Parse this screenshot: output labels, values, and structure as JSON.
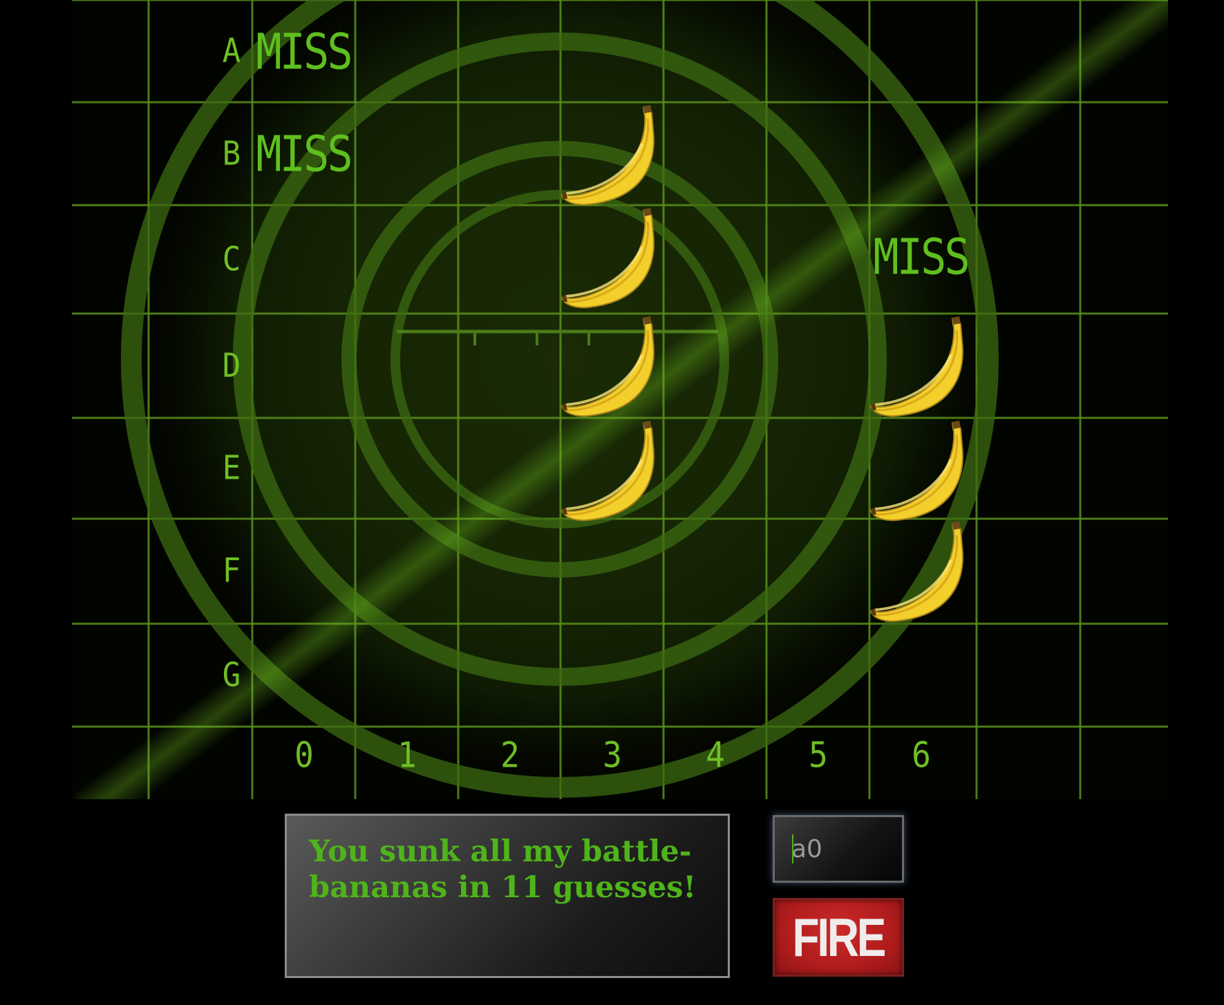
{
  "board": {
    "rows": [
      "A",
      "B",
      "C",
      "D",
      "E",
      "F",
      "G"
    ],
    "columns": [
      "0",
      "1",
      "2",
      "3",
      "4",
      "5",
      "6"
    ],
    "miss_label": "MISS",
    "misses": [
      {
        "row": 0,
        "col": 0
      },
      {
        "row": 1,
        "col": 0
      },
      {
        "row": 2,
        "col": 6
      }
    ],
    "hits": [
      {
        "row": 1,
        "col": 3
      },
      {
        "row": 2,
        "col": 3
      },
      {
        "row": 3,
        "col": 3
      },
      {
        "row": 4,
        "col": 3
      },
      {
        "row": 3,
        "col": 6
      },
      {
        "row": 4,
        "col": 6
      },
      {
        "row": 5,
        "col": 6
      }
    ],
    "hit_icon": "banana-icon"
  },
  "message": "You sunk all my battle-bananas in 11 guesses!",
  "guess_input": {
    "value": "a0"
  },
  "fire_button": {
    "label": "FIRE"
  },
  "colors": {
    "grid": "#5a8f1c",
    "label": "#6fbf24",
    "message_text": "#4fb41a",
    "fire": "#c02222"
  }
}
